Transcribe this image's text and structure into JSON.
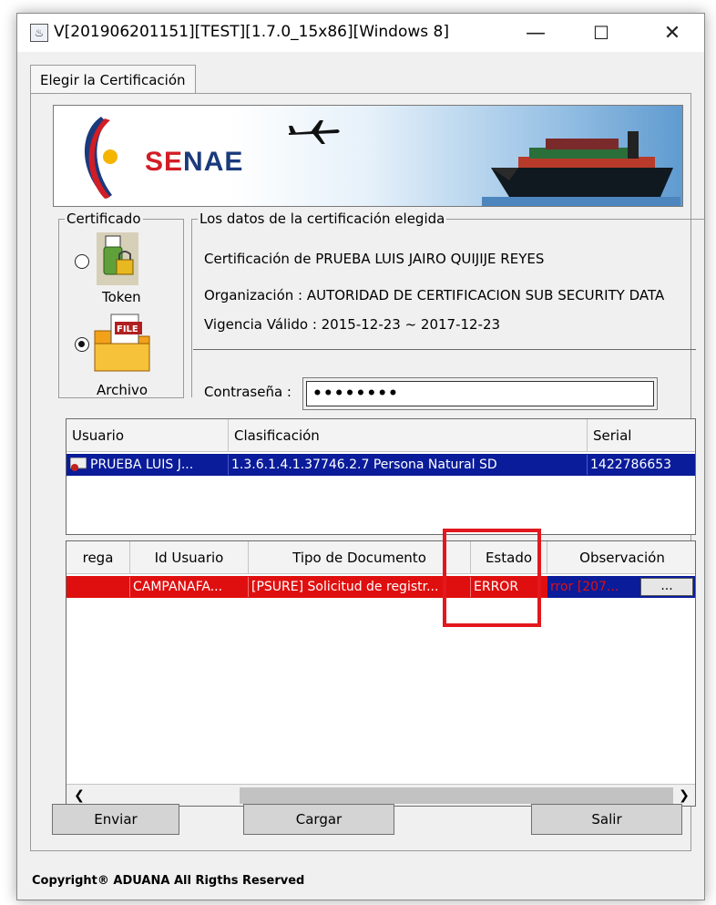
{
  "window": {
    "title": "V[201906201151][TEST][1.7.0_15x86][Windows 8]",
    "minimize_glyph": "—",
    "maximize_glyph": "☐",
    "close_glyph": "✕"
  },
  "tabs": [
    {
      "label": "Elegir la Certificación"
    }
  ],
  "banner": {
    "logo_part1": "SE",
    "logo_part2": "NAE"
  },
  "certificado": {
    "legend": "Certificado",
    "token_label": "Token",
    "archivo_label": "Archivo",
    "selected": "Archivo",
    "file_icon_text": "FILE"
  },
  "cert_info": {
    "legend": "Los datos de la certificación elegida",
    "name_line": "Certificación de PRUEBA LUIS JAIRO QUIJIJE REYES",
    "org_line": "Organización : AUTORIDAD DE CERTIFICACION SUB SECURITY DATA",
    "validity_line": "Vigencia Válido : 2015-12-23 ~ 2017-12-23",
    "password_label": "Contraseña :",
    "password_value": "••••••••"
  },
  "cert_table": {
    "headers": [
      "Usuario",
      "Clasificación",
      "Serial"
    ],
    "rows": [
      {
        "usuario": "PRUEBA LUIS J...",
        "clasificacion": "1.3.6.1.4.1.37746.2.7 Persona Natural SD",
        "serial": "1422786653"
      }
    ]
  },
  "doc_table": {
    "headers": [
      "rega",
      "Id Usuario",
      "Tipo de Documento",
      "Estado",
      "Observación"
    ],
    "rows": [
      {
        "entrega": "",
        "id_usuario": "CAMPANAFA...",
        "tipo": "[PSURE] Solicitud de registr...",
        "estado": "ERROR",
        "observacion": "rror [207...",
        "more": "..."
      }
    ],
    "scroll_left": "❮",
    "scroll_right": "❯"
  },
  "buttons": {
    "enviar": "Enviar",
    "cargar": "Cargar",
    "salir": "Salir"
  },
  "footer": "Copyright® ADUANA All Rigths Reserved",
  "colors": {
    "selection_blue": "#0a1c9a",
    "error_red": "#e00f0f",
    "highlight": "#e2181e"
  },
  "icons": {
    "app": "java-app-icon",
    "token": "usb-token-lock-icon",
    "archivo": "file-folder-icon",
    "cert_row": "certificate-icon"
  }
}
